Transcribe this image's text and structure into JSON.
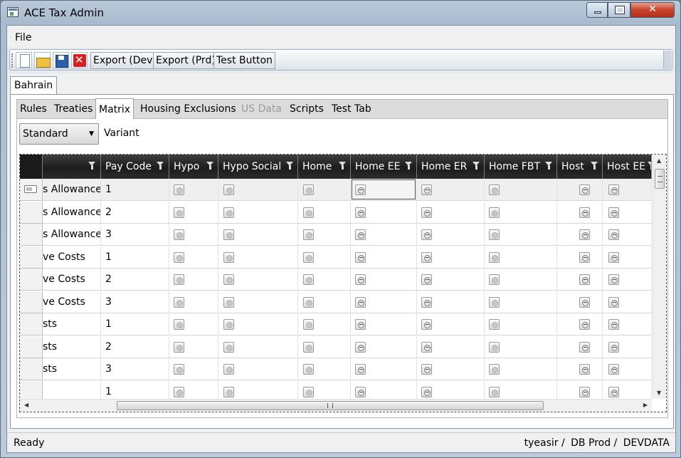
{
  "window": {
    "title": "ACE Tax Admin"
  },
  "menu": {
    "file": "File"
  },
  "toolbar": {
    "new_icon": "new-document-icon",
    "open_icon": "open-folder-icon",
    "save_icon": "save-disk-icon",
    "delete_icon": "delete-x-icon",
    "export_dev": "Export (Dev)",
    "export_prd": "Export (Prd)",
    "test_button": "Test Button"
  },
  "outer_tabs": [
    {
      "label": "Bahrain",
      "active": true
    }
  ],
  "inner_tabs": [
    {
      "label": "Rules"
    },
    {
      "label": "Treaties"
    },
    {
      "label": "Matrix",
      "active": true
    },
    {
      "label": "Housing Exclusions"
    },
    {
      "label": "US Data",
      "disabled": true
    },
    {
      "label": "Scripts"
    },
    {
      "label": "Test Tab"
    }
  ],
  "variant": {
    "selected": "Standard",
    "label": "Variant"
  },
  "grid": {
    "columns": [
      {
        "label": ""
      },
      {
        "label": "Pay Code"
      },
      {
        "label": "Hypo"
      },
      {
        "label": "Hypo Social"
      },
      {
        "label": "Home"
      },
      {
        "label": "Home EE"
      },
      {
        "label": "Home ER"
      },
      {
        "label": "Home FBT"
      },
      {
        "label": "Host"
      },
      {
        "label": "Host EE"
      }
    ],
    "rows": [
      {
        "name": "s Allowance",
        "pay_code": "1"
      },
      {
        "name": "s Allowance",
        "pay_code": "2"
      },
      {
        "name": "s Allowance",
        "pay_code": "3"
      },
      {
        "name": "ve Costs",
        "pay_code": "1"
      },
      {
        "name": "ve Costs",
        "pay_code": "2"
      },
      {
        "name": "ve Costs",
        "pay_code": "3"
      },
      {
        "name": "sts",
        "pay_code": "1"
      },
      {
        "name": "sts",
        "pay_code": "2"
      },
      {
        "name": "sts",
        "pay_code": "3"
      },
      {
        "name": "",
        "pay_code": "1"
      }
    ]
  },
  "status": {
    "text": "Ready",
    "user": "tyeasir /",
    "db": "DB Prod /",
    "data": "DEVDATA"
  }
}
